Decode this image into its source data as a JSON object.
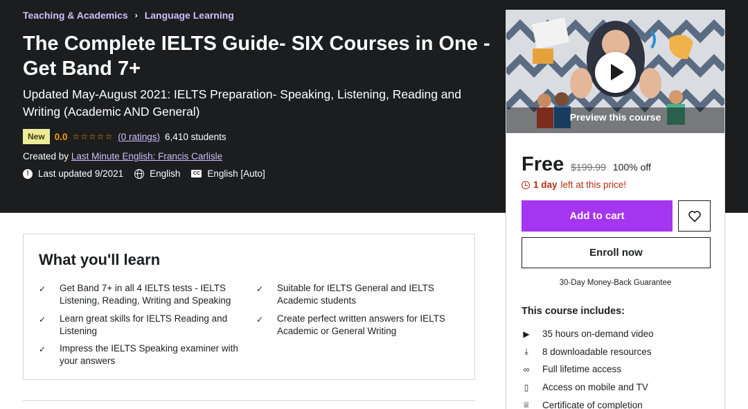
{
  "breadcrumb": {
    "items": [
      "Teaching & Academics",
      "Language Learning"
    ],
    "separator": "›"
  },
  "course": {
    "title": "The Complete IELTS Guide- SIX Courses in One - Get Band 7+",
    "subtitle": "Updated May-August 2021: IELTS Preparation- Speaking, Listening, Reading and Writing (Academic AND General)",
    "badge": "New",
    "rating": "0.0",
    "stars": "☆☆☆☆☆",
    "ratings_link": "(0 ratings)",
    "students": "6,410 students",
    "created_by_label": "Created by",
    "author": "Last Minute English: Francis Carlisle",
    "last_updated": "Last updated 9/2021",
    "language": "English",
    "captions": "English [Auto]"
  },
  "sidebar": {
    "preview_label": "Preview this course",
    "price": "Free",
    "original_price": "$199.99",
    "discount": "100% off",
    "timer_bold": "1 day",
    "timer_rest": "left at this price!",
    "add_to_cart": "Add to cart",
    "enroll": "Enroll now",
    "guarantee": "30-Day Money-Back Guarantee",
    "includes_title": "This course includes:",
    "includes": [
      {
        "icon": "video-icon",
        "glyph": "▶",
        "label": "35 hours on-demand video"
      },
      {
        "icon": "file-download-icon",
        "glyph": "⤓",
        "label": "8 downloadable resources"
      },
      {
        "icon": "infinity-icon",
        "glyph": "∞",
        "label": "Full lifetime access"
      },
      {
        "icon": "mobile-icon",
        "glyph": "▯",
        "label": "Access on mobile and TV"
      },
      {
        "icon": "trophy-icon",
        "glyph": "♕",
        "label": "Certificate of completion"
      }
    ]
  },
  "learn": {
    "title": "What you'll learn",
    "check": "✓",
    "left": [
      "Get Band 7+ in all 4 IELTS tests - IELTS Listening, Reading, Writing and Speaking",
      "Learn great skills for IELTS Reading and Listening",
      "Impress the IELTS Speaking examiner with your answers"
    ],
    "right": [
      "Suitable for IELTS General and IELTS Academic students",
      "Create perfect written answers for IELTS Academic or General Writing"
    ]
  },
  "colors": {
    "hero_bg": "#1c1d1f",
    "link_purple": "#cec0fc",
    "star_orange": "#f69c08",
    "cta_purple": "#a435f0",
    "timer_red": "#b32d0f"
  }
}
